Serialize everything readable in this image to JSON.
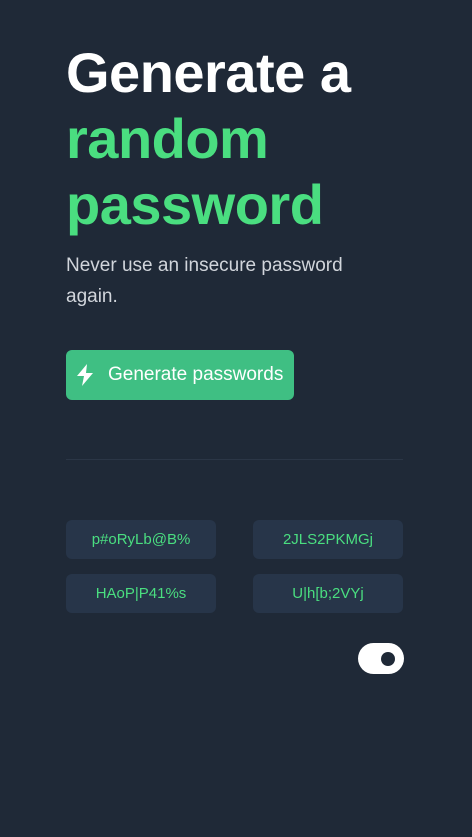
{
  "hero": {
    "title_line1": "Generate a",
    "title_line2": "random",
    "title_line3": "password",
    "subtitle": "Never use an insecure password again."
  },
  "generate_button": {
    "label": "Generate passwords",
    "icon": "lightning-bolt-icon"
  },
  "passwords": [
    "p#oRyLb@B%",
    "2JLS2PKMGj",
    "HAoP|P41%s",
    "U|h[b;2VYj"
  ],
  "toggle": {
    "state": "on"
  },
  "colors": {
    "background": "#1f2937",
    "accent": "#4ade80",
    "button": "#3fbf83",
    "card": "#273549"
  }
}
